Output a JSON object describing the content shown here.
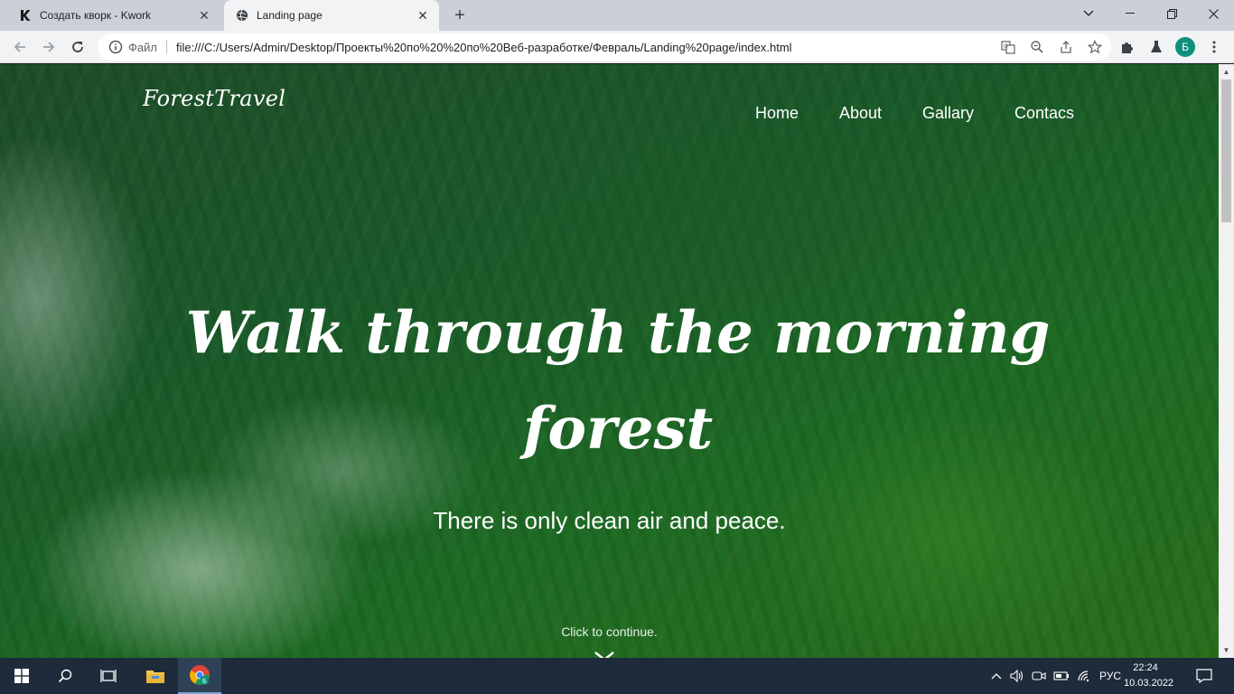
{
  "tabs": [
    {
      "title": "Создать кворк - Kwork",
      "icon": "kwork-logo-icon",
      "active": false
    },
    {
      "title": "Landing page",
      "icon": "globe-icon",
      "active": true
    }
  ],
  "omnibox": {
    "scheme_label": "Файл",
    "url": "file:///C:/Users/Admin/Desktop/Проекты%20по%20%20по%20Веб-разработке/Февраль/Landing%20page/index.html"
  },
  "profile": {
    "initial": "Б"
  },
  "page": {
    "logo": "ForestTravel",
    "nav": [
      "Home",
      "About",
      "Gallary",
      "Contacs"
    ],
    "hero_title": "Walk through the morning forest",
    "hero_subtitle": "There is only clean air and peace.",
    "continue_text": "Click to continue."
  },
  "taskbar": {
    "language": "РУС",
    "time": "22:24",
    "date": "10.03.2022"
  },
  "colors": {
    "tab_strip": "#cbd0d8",
    "toolbar": "#f1f3f4",
    "profile_bg": "#0f8e7e",
    "taskbar": "#1d2b3a",
    "forest_dark": "#1f4d2a",
    "forest_light": "#2a6e1c"
  }
}
